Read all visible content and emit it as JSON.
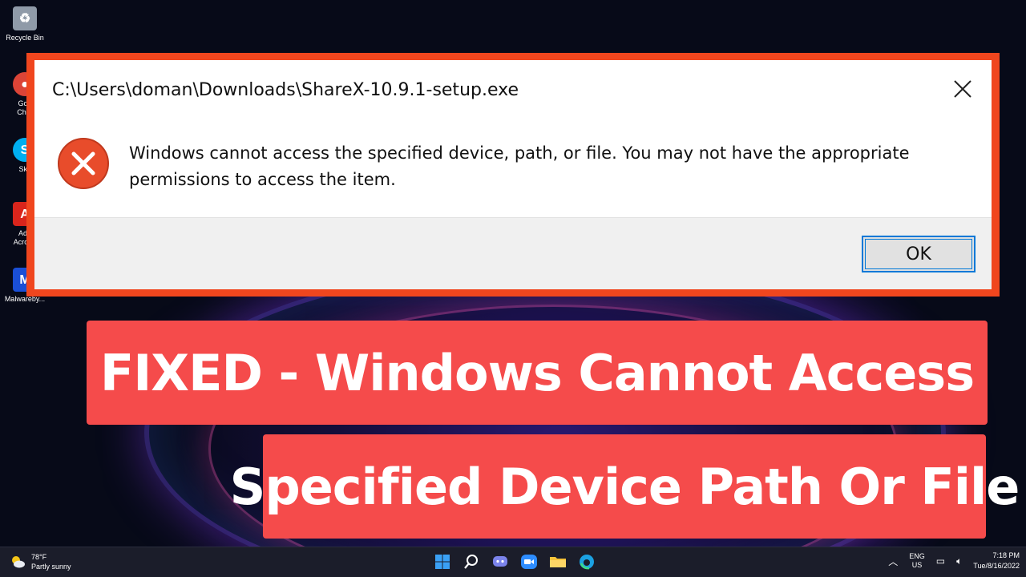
{
  "desktop": {
    "icons": [
      {
        "label": "Recycle Bin",
        "color": "#9aa4b0",
        "glyph": "♻"
      },
      {
        "label": "Goo\nChro",
        "color": "#db4437",
        "glyph": "●"
      },
      {
        "label": "Sky",
        "color": "#00aff0",
        "glyph": "S"
      },
      {
        "label": "Ado\nAcroba",
        "color": "#d9251c",
        "glyph": "A"
      },
      {
        "label": "Malwareby...",
        "color": "#1a4fd6",
        "glyph": "M"
      }
    ]
  },
  "dialog": {
    "title": "C:\\Users\\doman\\Downloads\\ShareX-10.9.1-setup.exe",
    "message": "Windows cannot access the specified device, path, or file. You may not have the appropriate permissions to access the item.",
    "ok_label": "OK",
    "border_color": "#f0461e",
    "error_color": "#e84c2b"
  },
  "banners": {
    "line1": "FIXED - Windows Cannot Access",
    "line2": "Specified Device Path Or File",
    "color": "#f54b4b"
  },
  "taskbar": {
    "weather_temp": "78°F",
    "weather_desc": "Partly sunny",
    "lang_top": "ENG",
    "lang_bottom": "US",
    "time": "7:18 PM",
    "date": "Tue/8/16/2022"
  }
}
